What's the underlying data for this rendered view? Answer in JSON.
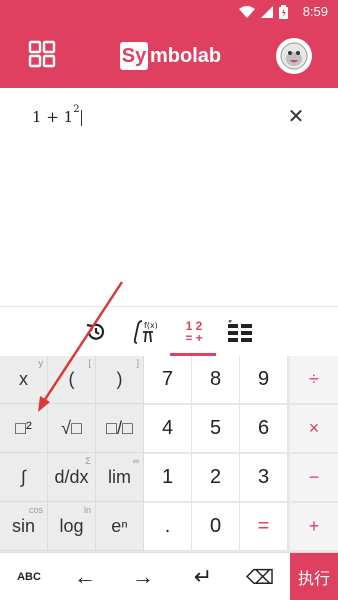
{
  "status": {
    "time": "8:59"
  },
  "app": {
    "logo_letter": "Sy",
    "logo_rest": "mbolab"
  },
  "editor": {
    "expr_base": "1 + 1",
    "expr_exp": "2",
    "clear": "✕"
  },
  "tabs": {
    "active_line1": "1  2",
    "active_line2": "=  +"
  },
  "keypad": {
    "r1": [
      "x",
      "(",
      ")",
      "7",
      "8",
      "9",
      "÷"
    ],
    "r1_hints": [
      "y",
      "[",
      "]"
    ],
    "r2": [
      "□²",
      "√□",
      "□/□",
      "4",
      "5",
      "6",
      "×"
    ],
    "r3": [
      "∫",
      "d/dx",
      "lim",
      "1",
      "2",
      "3",
      "−"
    ],
    "r3_hints": [
      "",
      "Σ",
      "∞"
    ],
    "r4": [
      "sin",
      "log",
      "eⁿ",
      ".",
      "0",
      "=",
      "+"
    ],
    "r4_hints": [
      "cos",
      "ln",
      ""
    ]
  },
  "bottom": {
    "abc": "ABC",
    "left": "←",
    "right": "→",
    "enter": "↵",
    "backspace": "⌫",
    "exec": "执行"
  },
  "colors": {
    "accent": "#e0405f"
  }
}
